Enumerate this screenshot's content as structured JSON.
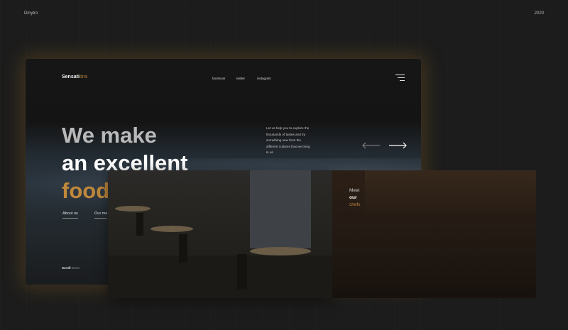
{
  "page": {
    "author": "Dmytro",
    "year": "2020"
  },
  "hero": {
    "logo": {
      "main": "Sensati",
      "accent": "ons"
    },
    "nav": [
      "facebook",
      "twitter",
      "instagram"
    ],
    "headline": [
      "We make",
      "an excellent",
      "food"
    ],
    "description": "Let us help you to explore the thousands of tastes and try something new from the different cultures that we bring in us",
    "links": [
      "About us",
      "Our me"
    ],
    "scroll": {
      "bold": "Scroll",
      "thin": "Down"
    }
  },
  "chefs": {
    "meet": "Meet",
    "our": "our",
    "chefs": "chefs"
  },
  "colors": {
    "accent": "#c0883b",
    "background": "#1c1c1c"
  }
}
